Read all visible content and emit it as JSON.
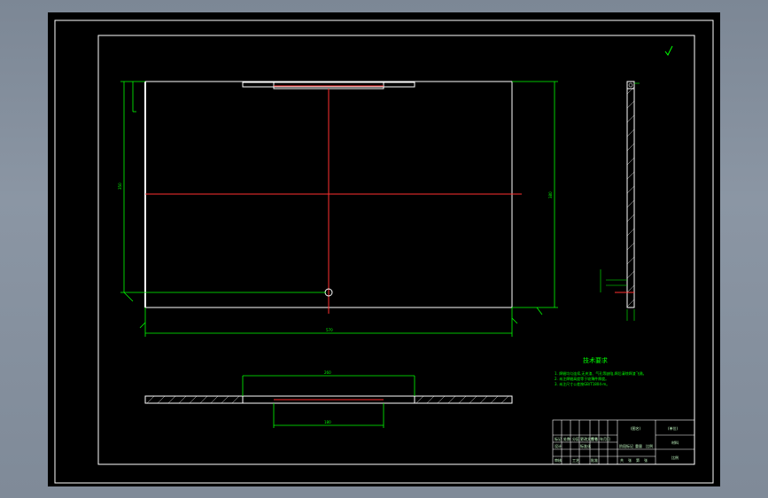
{
  "colors": {
    "background_outer": "#8b96a4",
    "canvas": "#000000",
    "geometry": "#ffffff",
    "dimension": "#00ff00",
    "centerline": "#ff3030"
  },
  "tech_notes": {
    "heading": "技术要求",
    "lines": [
      "1. 焊缝均匀连续,无夹渣、气孔等缺陷,焊后清除焊渣飞溅。",
      "2. 未注焊缝高度等于较薄件厚度。",
      "3. 未注尺寸公差按GB/T1804-m。"
    ]
  },
  "dimensions": {
    "left_height": "350",
    "right_height": "380",
    "bottom_width": "570",
    "top_section_width": "260",
    "bottom_section_width": "180"
  },
  "title_block": {
    "drawing_name": "(图名)",
    "material": "材料",
    "scale_label": "比例",
    "unit_name": "(单位)",
    "labels": [
      "标记",
      "处数",
      "分区",
      "更改文件号",
      "签名",
      "年月日"
    ],
    "row2": [
      "设计",
      "标准化",
      "阶段标记",
      "重量",
      "比例"
    ],
    "row3": [
      "审核",
      "工艺",
      "批准",
      "共",
      "张",
      "第",
      "张"
    ]
  }
}
